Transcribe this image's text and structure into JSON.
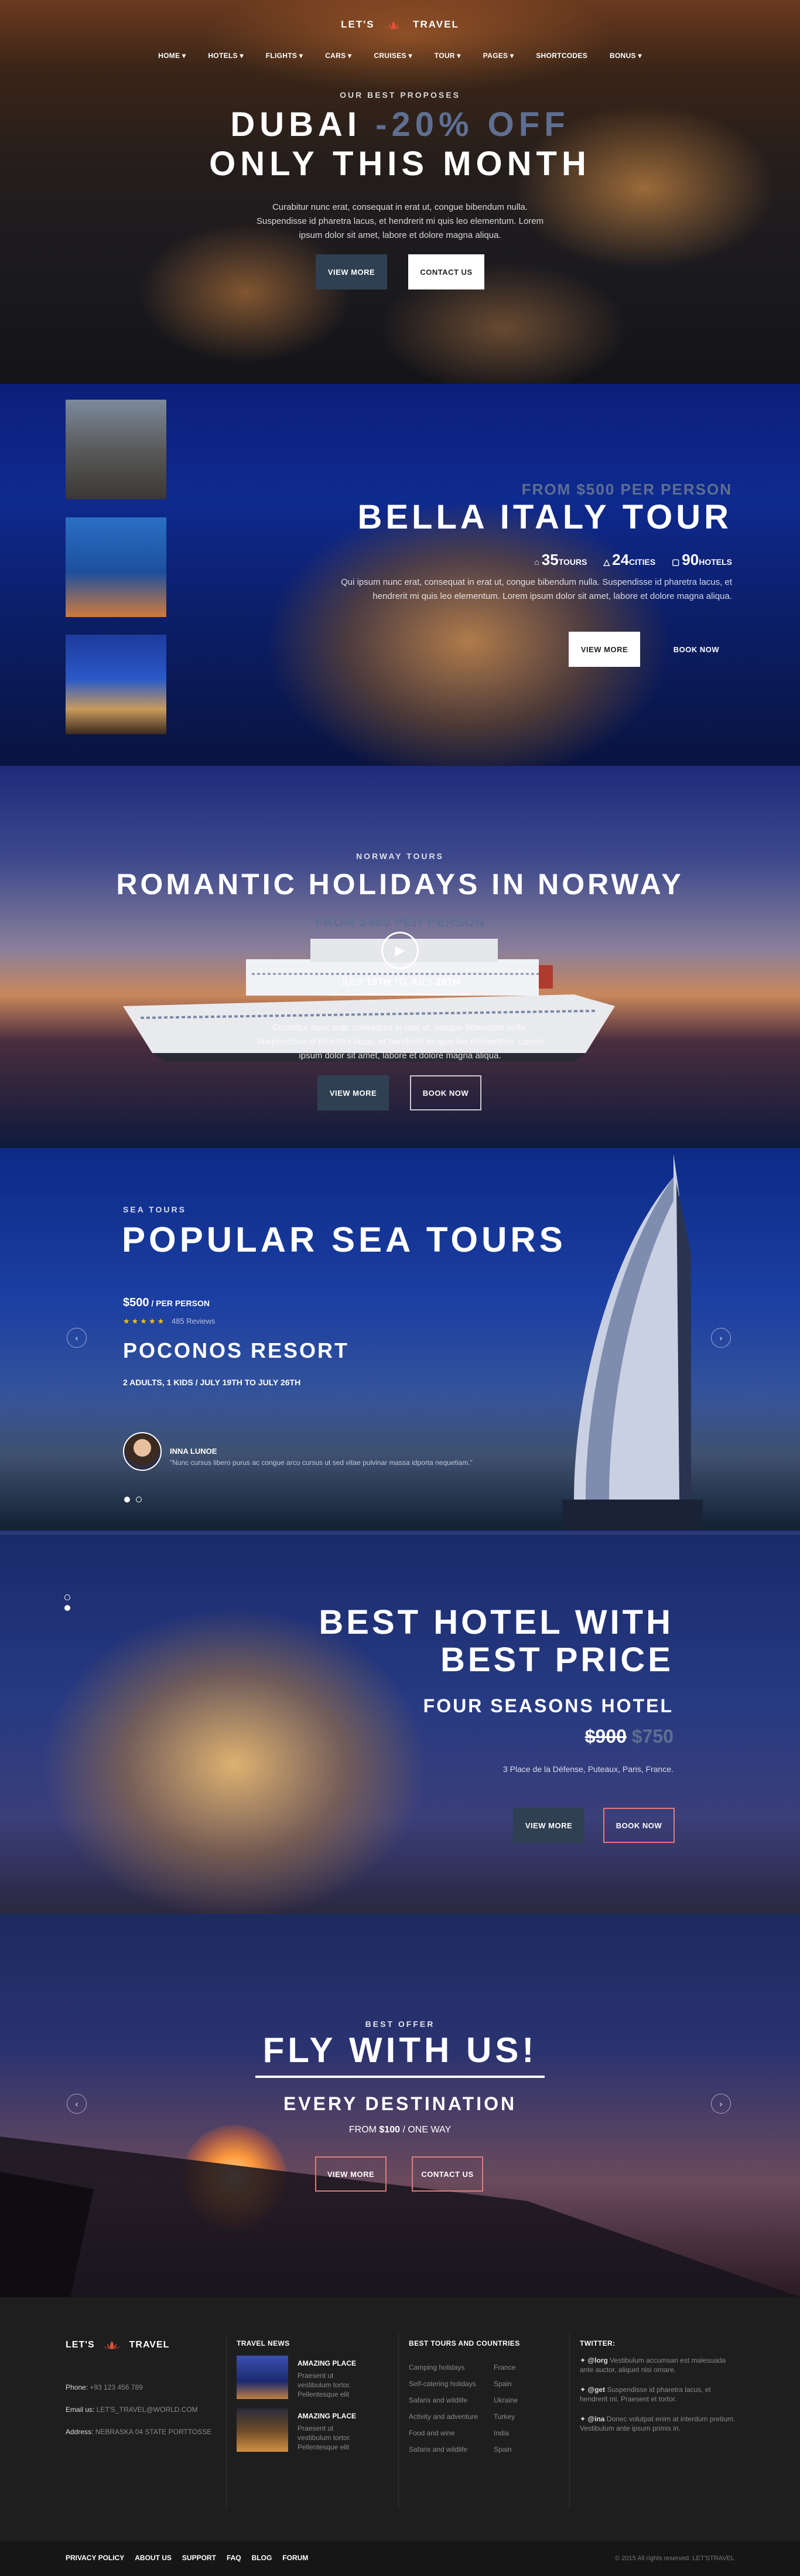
{
  "header": {
    "logo_left": "LET'S",
    "logo_right": "TRAVEL",
    "nav": [
      "HOME",
      "HOTELS",
      "FLIGHTS",
      "CARS",
      "CRUISES",
      "TOUR",
      "PAGES",
      "SHORTCODES",
      "BONUS"
    ]
  },
  "hero": {
    "kicker": "OUR BEST PROPOSES",
    "title_1": "DUBAI",
    "discount": "-20% OFF",
    "title_2": "ONLY THIS MONTH",
    "text": "Curabitur nunc erat, consequat in erat ut, congue bibendum nulla. Suspendisse id pharetra lacus, et hendrerit mi quis leo elementum. Lorem ipsum dolor sit amet, labore et dolore magna aliqua.",
    "btn_view": "VIEW MORE",
    "btn_contact": "CONTACT US"
  },
  "italy": {
    "price_label": "FROM $500 PER PERSON",
    "title": "BELLA ITALY TOUR",
    "stat_tours_num": "35",
    "stat_tours_label": "TOURS",
    "stat_cities_num": "24",
    "stat_cities_label": "CITIES",
    "stat_hotels_num": "90",
    "stat_hotels_label": "HOTELS",
    "text": "Qui ipsum nunc erat, consequat in erat ut, congue bibendum nulla. Suspendisse id pharetra lacus, et hendrerit mi quis leo elementum. Lorem ipsum dolor sit amet, labore et dolore magna aliqua.",
    "btn_view": "VIEW MORE",
    "btn_book": "BOOK NOW"
  },
  "norway": {
    "kicker": "NORWAY TOURS",
    "title": "ROMANTIC HOLIDAYS IN NORWAY",
    "price": "FROM $400 PER PERSON",
    "date_1": "JULY",
    "date_1_bold": "19TH",
    "date_sep": "TO JULY",
    "date_2_bold": "26TH",
    "text": "Curabitur nunc erat, consequat in erat ut, congue bibendum nulla. Suspendisse id pharetra lacus, et hendrerit mi quis leo elementum. Lorem ipsum dolor sit amet, labore et dolore magna aliqua.",
    "btn_view": "VIEW MORE",
    "btn_book": "BOOK NOW"
  },
  "sea": {
    "kicker": "SEA TOURS",
    "title": "POPULAR SEA TOURS",
    "price": "$500",
    "price_unit": "/ PER PERSON",
    "stars": "★★★★★",
    "reviews": "485 Reviews",
    "resort": "POCONOS RESORT",
    "details": "2 ADULTS, 1 KIDS / JULY 19TH TO JULY 26TH",
    "reviewer": "INNA LUNOE",
    "quote": "\"Nunc cursus libero purus ac congue arcu cursus ut sed vitae pulvinar massa idporta nequetiam.\"",
    "prev": "‹",
    "next": "›"
  },
  "hotel": {
    "title_1": "BEST HOTEL WITH",
    "title_2": "BEST PRICE",
    "name": "FOUR SEASONS HOTEL",
    "old_price": "$900",
    "new_price": "$750",
    "address": "3 Place de la Défense, Puteaux, Paris, France.",
    "btn_view": "VIEW MORE",
    "btn_book": "BOOK NOW"
  },
  "fly": {
    "kicker": "BEST OFFER",
    "title": "FLY WITH US!",
    "sub": "EVERY DESTINATION",
    "from": "FROM",
    "price": "$100",
    "way": "/ ONE WAY",
    "btn_view": "VIEW MORE",
    "btn_contact": "CONTACT US",
    "prev": "‹",
    "next": "›"
  },
  "footer": {
    "logo_left": "LET'S",
    "logo_right": "TRAVEL",
    "phone_label": "Phone:",
    "phone": "+93 123 456 789",
    "email_label": "Email us:",
    "email": "LET'S_TRAVEL@WORLD.COM",
    "address_label": "Address:",
    "address": "NEBRASKA 04 STATE PORTTOSSE",
    "news_title": "TRAVEL NEWS",
    "news": [
      {
        "title": "AMAZING PLACE",
        "text": "Praesent ut vestibulum tortor. Pellentesque elit"
      },
      {
        "title": "AMAZING PLACE",
        "text": "Praesent ut vestibulum tortor. Pellentesque elit"
      }
    ],
    "tours_title": "BEST TOURS AND COUNTRIES",
    "tours": [
      "Camping holidays",
      "Self-catering holidays",
      "Safaris and wildlife",
      "Activity and adventure",
      "Food and wine",
      "Safaris and wildlife"
    ],
    "countries": [
      "France",
      "Spain",
      "Ukraine",
      "Turkey",
      "India",
      "Spain"
    ],
    "twitter_title": "TWITTER:",
    "tweets": [
      {
        "handle": "@lorg",
        "text": "Vestibulum accumsan est malesuada ante auctor, aliquet nisi ornare."
      },
      {
        "handle": "@get",
        "text": "Suspendisse id pharetra lacus, et hendrerit mi. Praesent et tortor."
      },
      {
        "handle": "@ina",
        "text": "Donec volutpat enim at interdum pretium. Vestibulum ante ipsum primis in."
      }
    ],
    "bottom_links": [
      "PRIVACY POLICY",
      "ABOUT US",
      "SUPPORT",
      "FAQ",
      "BLOG",
      "FORUM"
    ],
    "copyright": "© 2015 All rights reserved. LET'STRAVEL"
  },
  "colors": {
    "accent": "#e8523a",
    "button_dark": "#2f4052",
    "price_muted": "#5e6f92",
    "star": "#f3c300"
  }
}
